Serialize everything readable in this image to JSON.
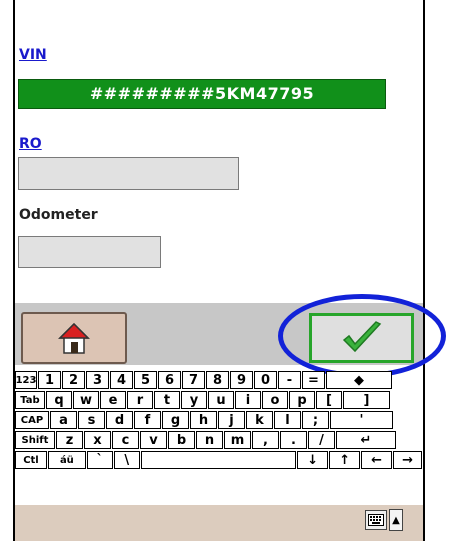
{
  "form": {
    "vin_label": "VIN",
    "vin_value": "#########5KM47795",
    "ro_label": "RO",
    "ro_value": "",
    "odometer_label": "Odometer",
    "odometer_value": ""
  },
  "toolbar": {
    "home_icon": "home-icon",
    "ok_icon": "checkmark-icon"
  },
  "keyboard": {
    "row1": [
      "123",
      "1",
      "2",
      "3",
      "4",
      "5",
      "6",
      "7",
      "8",
      "9",
      "0",
      "-",
      "=",
      "◆"
    ],
    "row2": [
      "Tab",
      "q",
      "w",
      "e",
      "r",
      "t",
      "y",
      "u",
      "i",
      "o",
      "p",
      "[",
      "]"
    ],
    "row3": [
      "CAP",
      "a",
      "s",
      "d",
      "f",
      "g",
      "h",
      "j",
      "k",
      "l",
      ";",
      "'"
    ],
    "row4": [
      "Shift",
      "z",
      "x",
      "c",
      "v",
      "b",
      "n",
      "m",
      ",",
      ".",
      "/",
      "↵"
    ],
    "row5": [
      "Ctl",
      "áü",
      "`",
      "\\",
      "",
      "↓",
      "↑",
      "←",
      "→"
    ]
  },
  "colors": {
    "vin_bg": "#11901a",
    "highlight_oval": "#1222d8",
    "ok_border": "#27a52a"
  }
}
